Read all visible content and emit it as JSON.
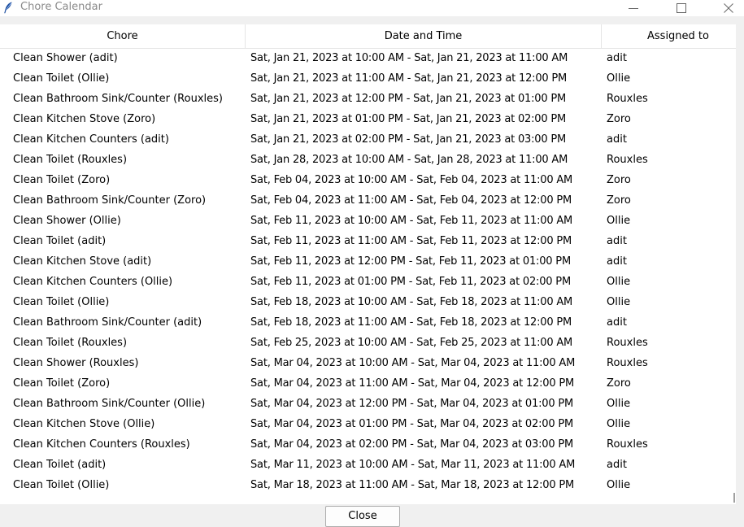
{
  "window": {
    "title": "Chore Calendar",
    "app_icon": "feather-icon",
    "controls": [
      "minimize-icon",
      "maximize-icon",
      "close-icon"
    ]
  },
  "table": {
    "headers": {
      "chore": "Chore",
      "date": "Date and Time",
      "assigned": "Assigned to"
    },
    "rows": [
      {
        "chore": "Clean Shower (adit)",
        "date": "Sat, Jan 21, 2023 at 10:00 AM - Sat, Jan 21, 2023 at 11:00 AM",
        "assigned": "adit"
      },
      {
        "chore": "Clean Toilet (Ollie)",
        "date": "Sat, Jan 21, 2023 at 11:00 AM - Sat, Jan 21, 2023 at 12:00 PM",
        "assigned": "Ollie"
      },
      {
        "chore": "Clean Bathroom Sink/Counter (Rouxles)",
        "date": "Sat, Jan 21, 2023 at 12:00 PM - Sat, Jan 21, 2023 at 01:00 PM",
        "assigned": "Rouxles"
      },
      {
        "chore": "Clean Kitchen Stove (Zoro)",
        "date": "Sat, Jan 21, 2023 at 01:00 PM - Sat, Jan 21, 2023 at 02:00 PM",
        "assigned": "Zoro"
      },
      {
        "chore": "Clean Kitchen Counters (adit)",
        "date": "Sat, Jan 21, 2023 at 02:00 PM - Sat, Jan 21, 2023 at 03:00 PM",
        "assigned": "adit"
      },
      {
        "chore": "Clean Toilet (Rouxles)",
        "date": "Sat, Jan 28, 2023 at 10:00 AM - Sat, Jan 28, 2023 at 11:00 AM",
        "assigned": "Rouxles"
      },
      {
        "chore": "Clean Toilet (Zoro)",
        "date": "Sat, Feb 04, 2023 at 10:00 AM - Sat, Feb 04, 2023 at 11:00 AM",
        "assigned": "Zoro"
      },
      {
        "chore": "Clean Bathroom Sink/Counter (Zoro)",
        "date": "Sat, Feb 04, 2023 at 11:00 AM - Sat, Feb 04, 2023 at 12:00 PM",
        "assigned": "Zoro"
      },
      {
        "chore": "Clean Shower (Ollie)",
        "date": "Sat, Feb 11, 2023 at 10:00 AM - Sat, Feb 11, 2023 at 11:00 AM",
        "assigned": "Ollie"
      },
      {
        "chore": "Clean Toilet (adit)",
        "date": "Sat, Feb 11, 2023 at 11:00 AM - Sat, Feb 11, 2023 at 12:00 PM",
        "assigned": "adit"
      },
      {
        "chore": "Clean Kitchen Stove (adit)",
        "date": "Sat, Feb 11, 2023 at 12:00 PM - Sat, Feb 11, 2023 at 01:00 PM",
        "assigned": "adit"
      },
      {
        "chore": "Clean Kitchen Counters (Ollie)",
        "date": "Sat, Feb 11, 2023 at 01:00 PM - Sat, Feb 11, 2023 at 02:00 PM",
        "assigned": "Ollie"
      },
      {
        "chore": "Clean Toilet (Ollie)",
        "date": "Sat, Feb 18, 2023 at 10:00 AM - Sat, Feb 18, 2023 at 11:00 AM",
        "assigned": "Ollie"
      },
      {
        "chore": "Clean Bathroom Sink/Counter (adit)",
        "date": "Sat, Feb 18, 2023 at 11:00 AM - Sat, Feb 18, 2023 at 12:00 PM",
        "assigned": "adit"
      },
      {
        "chore": "Clean Toilet (Rouxles)",
        "date": "Sat, Feb 25, 2023 at 10:00 AM - Sat, Feb 25, 2023 at 11:00 AM",
        "assigned": "Rouxles"
      },
      {
        "chore": "Clean Shower (Rouxles)",
        "date": "Sat, Mar 04, 2023 at 10:00 AM - Sat, Mar 04, 2023 at 11:00 AM",
        "assigned": "Rouxles"
      },
      {
        "chore": "Clean Toilet (Zoro)",
        "date": "Sat, Mar 04, 2023 at 11:00 AM - Sat, Mar 04, 2023 at 12:00 PM",
        "assigned": "Zoro"
      },
      {
        "chore": "Clean Bathroom Sink/Counter (Ollie)",
        "date": "Sat, Mar 04, 2023 at 12:00 PM - Sat, Mar 04, 2023 at 01:00 PM",
        "assigned": "Ollie"
      },
      {
        "chore": "Clean Kitchen Stove (Ollie)",
        "date": "Sat, Mar 04, 2023 at 01:00 PM - Sat, Mar 04, 2023 at 02:00 PM",
        "assigned": "Ollie"
      },
      {
        "chore": "Clean Kitchen Counters (Rouxles)",
        "date": "Sat, Mar 04, 2023 at 02:00 PM - Sat, Mar 04, 2023 at 03:00 PM",
        "assigned": "Rouxles"
      },
      {
        "chore": "Clean Toilet (adit)",
        "date": "Sat, Mar 11, 2023 at 10:00 AM - Sat, Mar 11, 2023 at 11:00 AM",
        "assigned": "adit"
      },
      {
        "chore": "Clean Toilet (Ollie)",
        "date": "Sat, Mar 18, 2023 at 11:00 AM - Sat, Mar 18, 2023 at 12:00 PM",
        "assigned": "Ollie"
      }
    ]
  },
  "footer": {
    "close_label": "Close"
  }
}
